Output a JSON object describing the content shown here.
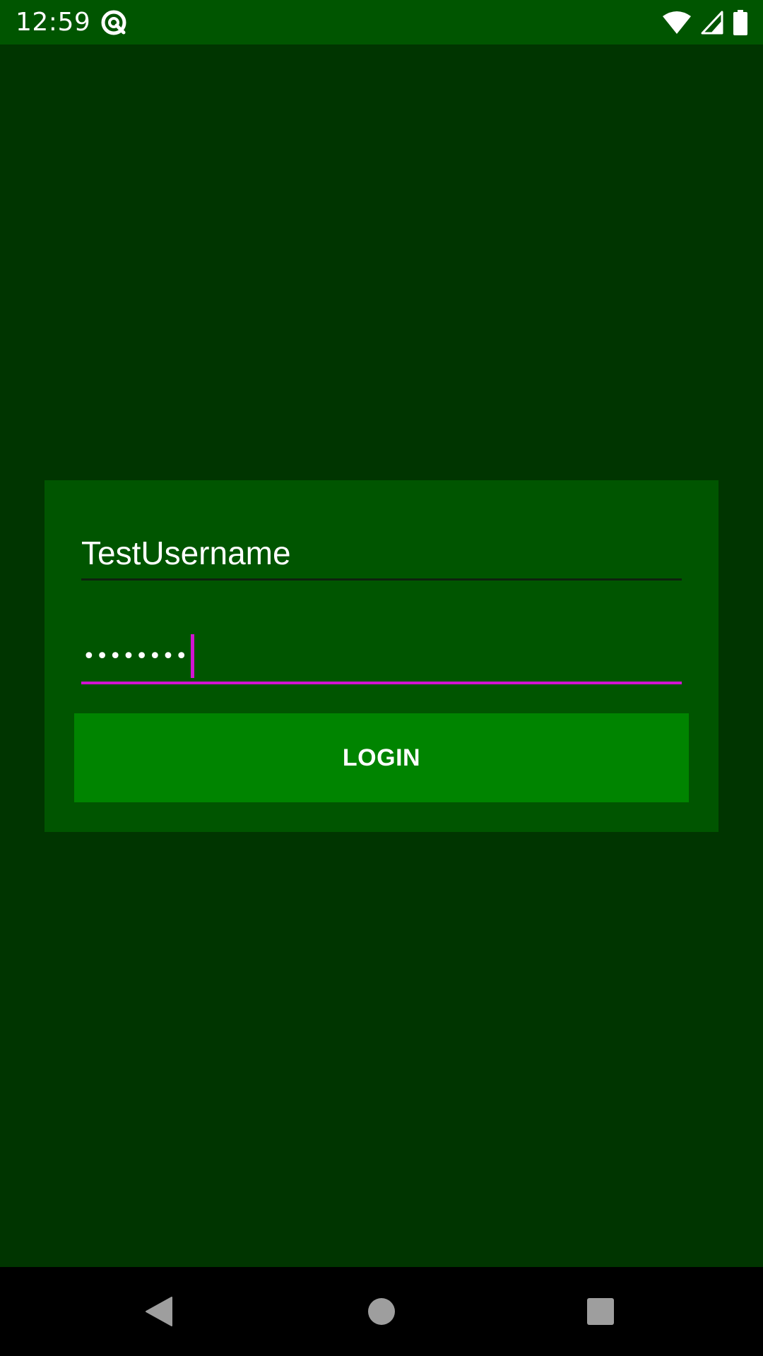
{
  "status_bar": {
    "time": "12:59",
    "app_icon": "at-sign-icon",
    "wifi_icon": "wifi-icon",
    "signal_icon": "cell-signal-icon",
    "battery_icon": "battery-icon",
    "bg_color": "#005500"
  },
  "login": {
    "username": {
      "value": "TestUsername",
      "underline_color": "#0f220f"
    },
    "password": {
      "masked_value": "••••••••",
      "focused": true,
      "accent_color": "#d014d0"
    },
    "button_label": "LOGIN",
    "button_color": "#008400",
    "card_color": "#005500",
    "background_color": "#003500"
  },
  "nav_bar": {
    "back_icon": "back-triangle-icon",
    "home_icon": "home-circle-icon",
    "recents_icon": "recents-square-icon"
  }
}
